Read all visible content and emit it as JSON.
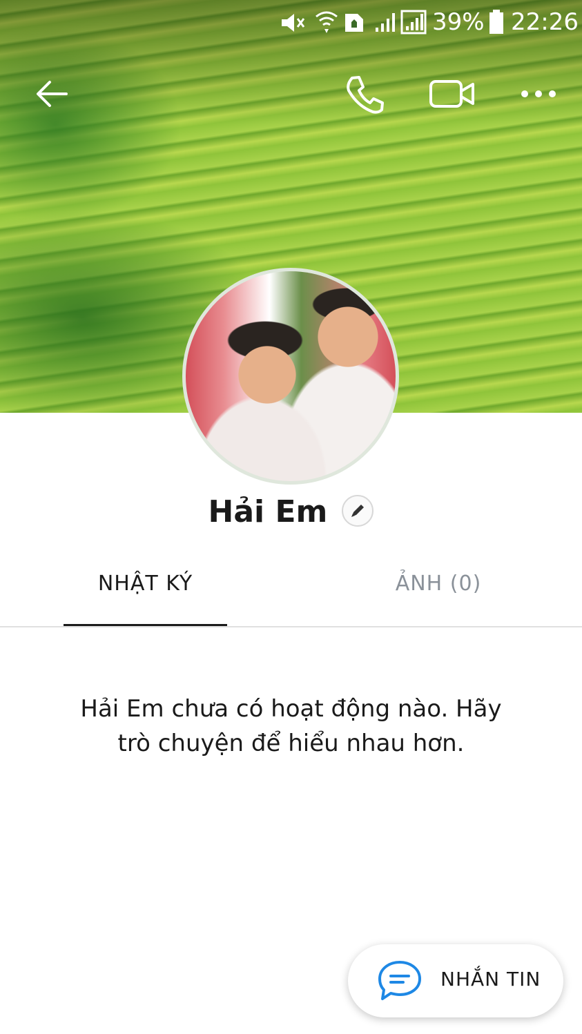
{
  "status_bar": {
    "battery_percent": "39%",
    "time": "22:26",
    "icons": [
      "mute-icon",
      "wifi-icon",
      "notification-icon",
      "signal-icon",
      "signal-icon",
      "battery-icon"
    ]
  },
  "header": {
    "icons": [
      "back-arrow-icon",
      "phone-icon",
      "video-call-icon",
      "more-icon"
    ]
  },
  "profile": {
    "name": "Hải Em",
    "edit_icon": "pencil-icon"
  },
  "tabs": [
    {
      "label": "NHẬT KÝ",
      "active": true
    },
    {
      "label": "ẢNH (0)",
      "active": false
    }
  ],
  "content": {
    "empty_message": "Hải Em chưa có hoạt động nào. Hãy trò chuyện để hiểu nhau hơn."
  },
  "fab": {
    "label": "NHẮN TIN",
    "icon": "chat-bubble-icon"
  },
  "colors": {
    "accent": "#1e88e5",
    "text": "#1a1a1a",
    "inactive_tab": "#8a9199"
  }
}
